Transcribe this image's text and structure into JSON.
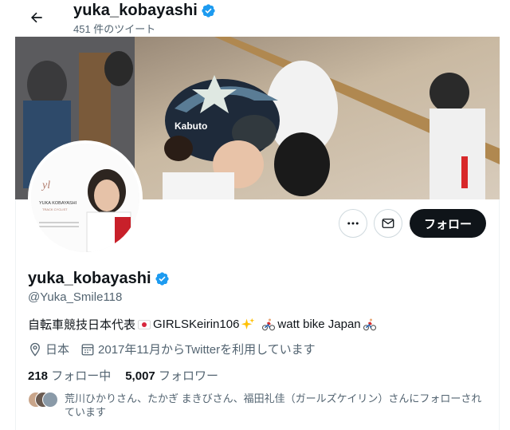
{
  "header": {
    "name": "yuka_kobayashi",
    "tweet_count": "451 件のツイート"
  },
  "banner": {
    "helmet_brand": "Kabuto"
  },
  "avatar": {
    "brand_text": "YUKA KOBAYASHI",
    "sub_text": "TRACK CYCLIST"
  },
  "actions": {
    "follow_label": "フォロー"
  },
  "profile": {
    "name": "yuka_kobayashi",
    "handle": "@Yuka_Smile118",
    "bio_part1": "自転車競技日本代表",
    "bio_part2": "GIRLSKeirin106",
    "bio_part3": "watt bike Japan",
    "location": "日本",
    "joined": "2017年11月からTwitterを利用しています"
  },
  "stats": {
    "following_count": "218",
    "following_label": "フォロー中",
    "followers_count": "5,007",
    "followers_label": "フォロワー"
  },
  "followed_by": {
    "text": "荒川ひかりさん、たかぎ まきびさん、福田礼佳（ガールズケイリン）さんにフォローされています"
  },
  "colors": {
    "verified": "#1d9bf0",
    "follow_button": "#0f1419",
    "secondary_text": "#536471"
  }
}
